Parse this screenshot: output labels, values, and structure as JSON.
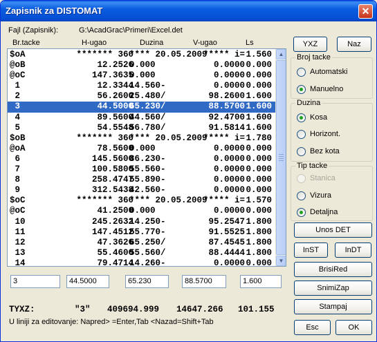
{
  "window": {
    "title": "Zapisnik za DISTOMAT",
    "close": "✕"
  },
  "file": {
    "label": "Fajl (Zapisnik):",
    "path": "G:\\AcadGrac\\Primeri\\Excel.det"
  },
  "columns": [
    "Br.tacke",
    "H-ugao",
    "Duzina",
    "V-ugao",
    "Ls"
  ],
  "rows": [
    [
      "$oA",
      "******* 360",
      "**** 20.05.2009",
      "***** i=",
      "1.560"
    ],
    [
      "@oB",
      "12.2526",
      "0.000",
      "0.0000",
      "0.000"
    ],
    [
      "@oC",
      "147.3635",
      "0.000",
      "0.0000",
      "0.000"
    ],
    [
      " 1",
      "12.3344",
      "14.560-",
      "0.0000",
      "0.000"
    ],
    [
      " 2",
      "56.2600",
      "25.480/",
      "98.2600",
      "1.600"
    ],
    [
      " 3",
      "44.5000",
      "65.230/",
      "88.5700",
      "1.600"
    ],
    [
      " 4",
      "89.5600",
      "44.560/",
      "92.4700",
      "1.600"
    ],
    [
      " 5",
      "54.5548",
      "56.780/",
      "91.5814",
      "1.600"
    ],
    [
      "$oB",
      "******* 360",
      "**** 20.05.2009",
      "***** i=",
      "1.780"
    ],
    [
      "@oA",
      "78.5600",
      "0.000",
      "0.0000",
      "0.000"
    ],
    [
      " 6",
      "145.5600",
      "86.230-",
      "0.0000",
      "0.000"
    ],
    [
      " 7",
      "100.5800",
      "55.560-",
      "0.0000",
      "0.000"
    ],
    [
      " 8",
      "258.4747",
      "55.890-",
      "0.0000",
      "0.000"
    ],
    [
      " 9",
      "312.5438",
      "42.560-",
      "0.0000",
      "0.000"
    ],
    [
      "$oC",
      "******* 360",
      "**** 20.05.2009",
      "***** i=",
      "1.570"
    ],
    [
      "@oC",
      "41.2500",
      "0.000",
      "0.0000",
      "0.000"
    ],
    [
      " 10",
      "245.2632",
      "14.250-",
      "95.2547",
      "1.800"
    ],
    [
      " 11",
      "147.4512",
      "55.770-",
      "91.5525",
      "1.800"
    ],
    [
      " 12",
      "47.3626",
      "65.250/",
      "87.4545",
      "1.800"
    ],
    [
      " 13",
      "55.4600",
      "55.560/",
      "88.4444",
      "1.800"
    ],
    [
      " 14",
      "79.4714",
      "14.260-",
      "0.0000",
      "0.000"
    ]
  ],
  "selected_row": 5,
  "edit_fields": [
    "3",
    "44.5000",
    "65.230",
    "88.5700",
    "1.600"
  ],
  "tyxz": {
    "label": "TYXZ:",
    "point": "\"3\"",
    "y": "409694.999",
    "x": "14647.266",
    "z": "101.155"
  },
  "hint": "U liniji za editovanje: Napred> =Enter,Tab    <Nazad=Shift+Tab",
  "buttons": {
    "yxz": "YXZ",
    "naz": "Naz",
    "unos_det": "Unos DET",
    "inst": "InST",
    "indt": "InDT",
    "brisired": "BrisiRed",
    "snimizap": "SnimiZap",
    "stampaj": "Stampaj",
    "esc": "Esc",
    "ok": "OK"
  },
  "groups": {
    "broj_tacke": {
      "title": "Broj tacke",
      "options": [
        "Automatski",
        "Manuelno"
      ],
      "selected": "Manuelno"
    },
    "duzina": {
      "title": "Duzina",
      "options": [
        "Kosa",
        "Horizont.",
        "Bez kota"
      ],
      "selected": "Kosa"
    },
    "tip_tacke": {
      "title": "Tip tacke",
      "options": [
        "Stanica",
        "Vizura",
        "Detaljna"
      ],
      "selected": "Detaljna",
      "disabled": [
        "Stanica"
      ]
    }
  },
  "colors": {
    "selection": "#316ac5",
    "titlebar": "#0a5ddf",
    "face": "#ece9d8"
  }
}
